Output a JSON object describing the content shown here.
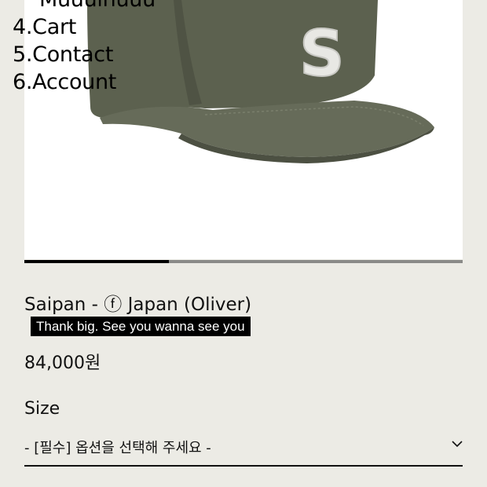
{
  "nav": {
    "partial_item": "Muuulhuuu",
    "items": [
      "4.Cart",
      "5.Contact",
      "6.Account"
    ]
  },
  "product": {
    "image_icon": "olive-baseball-cap-with-S-logo",
    "image_slider_progress": 0.33,
    "name": "Saipan - ⓕ Japan (Oliver)",
    "caption": "Thank big. See you wanna see you",
    "price": "84,000원"
  },
  "options": {
    "size_label": "Size",
    "size_select_value": "- [필수] 옵션을 선택해 주세요 -",
    "select_icon": "chevron-down-icon"
  },
  "colors": {
    "background": "#ecebe5",
    "cap_olive": "#5a5f4f",
    "text": "#111111"
  }
}
